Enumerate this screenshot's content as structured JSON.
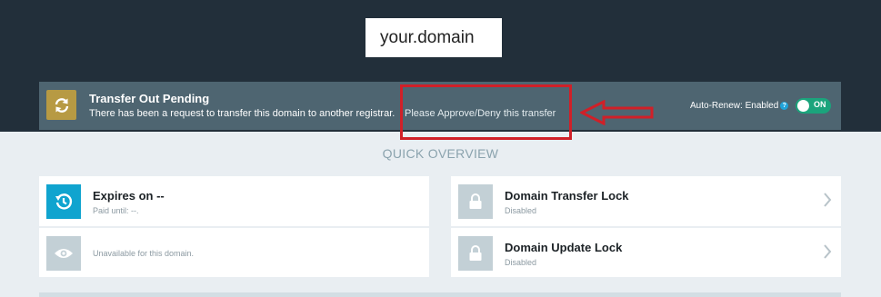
{
  "header": {
    "domain": "your.domain"
  },
  "notice": {
    "title": "Transfer Out Pending",
    "message": "There has been a request to transfer this domain to another registrar.",
    "action_link": "Please Approve/Deny this transfer",
    "icon": "refresh-icon"
  },
  "auto_renew": {
    "label": "Auto-Renew: Enabled",
    "help": "?",
    "toggle_label": "ON",
    "state": true
  },
  "overview": {
    "title": "QUICK OVERVIEW",
    "expires": {
      "title": "Expires on --",
      "sub": "Paid until: --."
    },
    "privacy": {
      "text": "Unavailable for this domain."
    },
    "transfer_lock": {
      "title": "Domain Transfer Lock",
      "status": "Disabled"
    },
    "update_lock": {
      "title": "Domain Update Lock",
      "status": "Disabled"
    }
  },
  "colors": {
    "dark_header": "#222f3a",
    "notice_bar": "#4e6571",
    "notice_icon": "#b79a43",
    "expires_icon": "#10a4cf",
    "toggle_on": "#1ba47c",
    "annotation": "#d02028"
  }
}
